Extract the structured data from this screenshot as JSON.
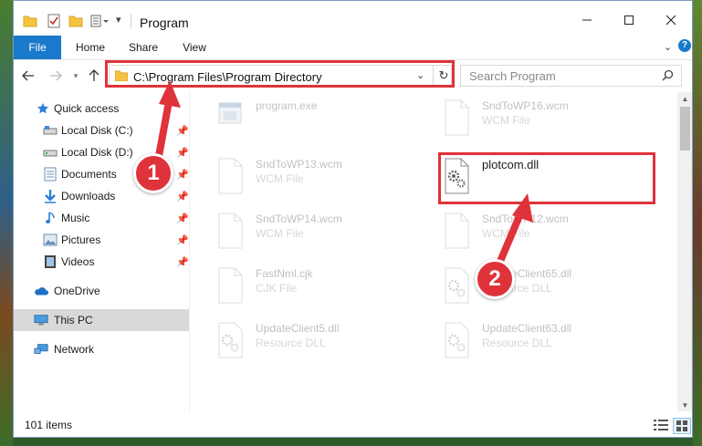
{
  "window": {
    "title": "Program",
    "controls": {
      "minimize": "—",
      "maximize": "☐",
      "close": "✕"
    }
  },
  "ribbon": {
    "tabs": [
      {
        "label": "File",
        "active": true
      },
      {
        "label": "Home"
      },
      {
        "label": "Share"
      },
      {
        "label": "View"
      }
    ]
  },
  "address": {
    "path": "C:\\Program Files\\Program Directory"
  },
  "search": {
    "placeholder": "Search Program"
  },
  "sidebar": {
    "items": [
      {
        "label": "Quick access",
        "icon": "star-icon"
      },
      {
        "label": "Local Disk (C:)",
        "icon": "drive-icon",
        "pinned": true
      },
      {
        "label": "Local Disk (D:)",
        "icon": "drive-icon",
        "pinned": true
      },
      {
        "label": "Documents",
        "icon": "documents-icon",
        "pinned": true
      },
      {
        "label": "Downloads",
        "icon": "download-icon",
        "pinned": true
      },
      {
        "label": "Music",
        "icon": "music-icon",
        "pinned": true
      },
      {
        "label": "Pictures",
        "icon": "pictures-icon",
        "pinned": true
      },
      {
        "label": "Videos",
        "icon": "videos-icon",
        "pinned": true
      },
      {
        "label": "OneDrive",
        "icon": "cloud-icon"
      },
      {
        "label": "This PC",
        "icon": "computer-icon",
        "selected": true
      },
      {
        "label": "Network",
        "icon": "network-icon"
      }
    ]
  },
  "files": [
    {
      "name": "program.exe",
      "type": "",
      "icon": "exe-icon",
      "highlighted": false
    },
    {
      "name": "SndToWP16.wcm",
      "type": "WCM File",
      "icon": "file-icon",
      "highlighted": false
    },
    {
      "name": "SndToWP13.wcm",
      "type": "WCM File",
      "icon": "file-icon",
      "highlighted": false
    },
    {
      "name": "plotcom.dll",
      "type": "",
      "icon": "dll-gear-icon",
      "highlighted": true
    },
    {
      "name": "SndToWP14.wcm",
      "type": "WCM File",
      "icon": "file-icon",
      "highlighted": false
    },
    {
      "name": "SndToWP12.wcm",
      "type": "WCM File",
      "icon": "file-icon",
      "highlighted": false
    },
    {
      "name": "FastNml.cjk",
      "type": "CJK File",
      "icon": "file-icon",
      "highlighted": false
    },
    {
      "name": "UpdateClient65.dll",
      "type": "Resource DLL",
      "icon": "dll-gear-icon",
      "highlighted": false
    },
    {
      "name": "UpdateClient5.dll",
      "type": "Resource DLL",
      "icon": "dll-gear-icon",
      "highlighted": false
    },
    {
      "name": "UpdateClient63.dll",
      "type": "Resource DLL",
      "icon": "dll-gear-icon",
      "highlighted": false
    }
  ],
  "status": {
    "item_count": "101 items"
  },
  "annotations": {
    "step1": "1",
    "step2": "2",
    "color": "#e0323a"
  }
}
